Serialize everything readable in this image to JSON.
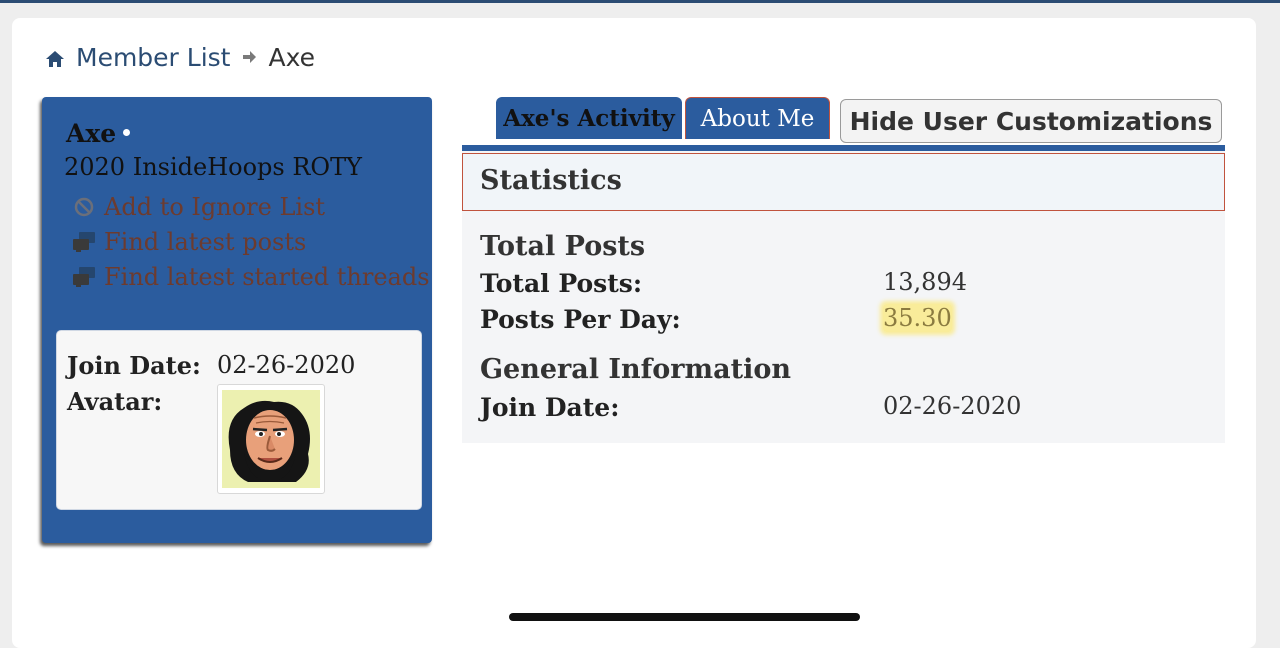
{
  "breadcrumb": {
    "home_icon": "home-icon",
    "link": "Member List",
    "current": "Axe"
  },
  "profile": {
    "username": "Axe",
    "title": "2020 InsideHoops ROTY",
    "actions": [
      {
        "label": "Add to Ignore List",
        "icon": "ignore-icon"
      },
      {
        "label": "Find latest posts",
        "icon": "posts-icon"
      },
      {
        "label": "Find latest started threads",
        "icon": "threads-icon"
      }
    ],
    "info": {
      "join_date_label": "Join Date:",
      "join_date_value": "02-26-2020",
      "avatar_label": "Avatar:"
    }
  },
  "tabs": [
    {
      "label": "Axe's Activity"
    },
    {
      "label": "About Me"
    }
  ],
  "hide_button": "Hide User Customizations",
  "statistics": {
    "title": "Statistics",
    "total_posts_section": "Total Posts",
    "total_posts_label": "Total Posts:",
    "total_posts_value": "13,894",
    "posts_per_day_label": "Posts Per Day:",
    "posts_per_day_value": "35.30",
    "general_section": "General Information",
    "join_date_label": "Join Date:",
    "join_date_value": "02-26-2020"
  },
  "colors": {
    "brand_blue": "#2b5c9e",
    "link_blue": "#2b4c73",
    "action_brown": "#6d3b2e",
    "tab_accent": "#c0533e",
    "highlight": "#f9ec9a"
  }
}
